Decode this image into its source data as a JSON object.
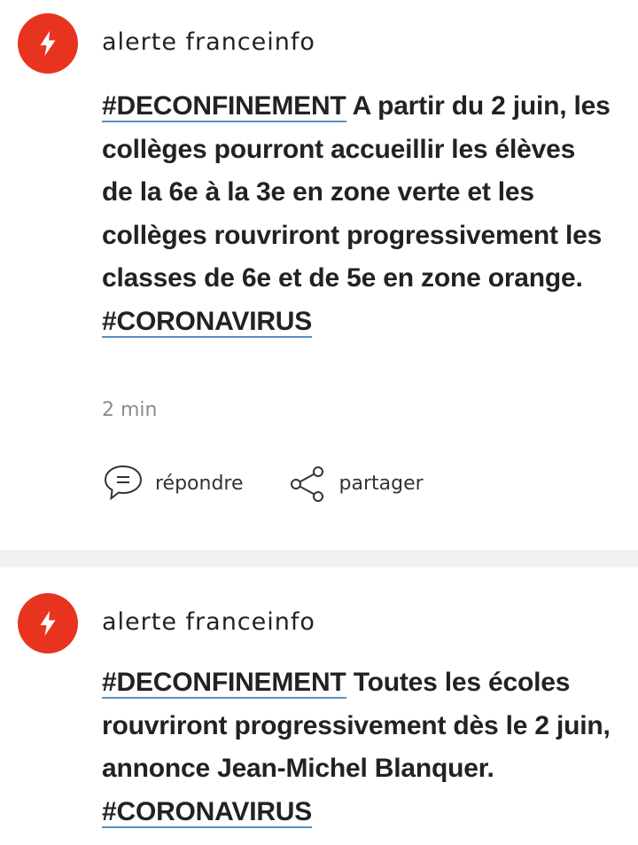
{
  "posts": [
    {
      "author": "alerte franceinfo",
      "hashtag_start": "#DECONFINEMENT",
      "text": " A partir du 2 juin, les collèges pourront accueillir les élèves de la 6e à la 3e en zone verte et les collèges rouvriront progressivement les classes de 6e et de 5e en zone orange. ",
      "hashtag_end": "#CORONAVIRUS",
      "time": "2 min",
      "actions": {
        "reply_label": "répondre",
        "share_label": "partager"
      }
    },
    {
      "author": "alerte franceinfo",
      "hashtag_start": "#DECONFINEMENT",
      "text": " Toutes les écoles rouvriront progressivement dès le 2 juin, annonce Jean-Michel Blanquer. ",
      "hashtag_end": "#CORONAVIRUS"
    }
  ],
  "colors": {
    "avatar_bg": "#e8331e",
    "hashtag_underline": "#5a8fc0",
    "separator": "#f1f1f1"
  },
  "icons": {
    "avatar": "lightning-bolt-icon",
    "reply": "speech-bubble-icon",
    "share": "share-icon"
  }
}
